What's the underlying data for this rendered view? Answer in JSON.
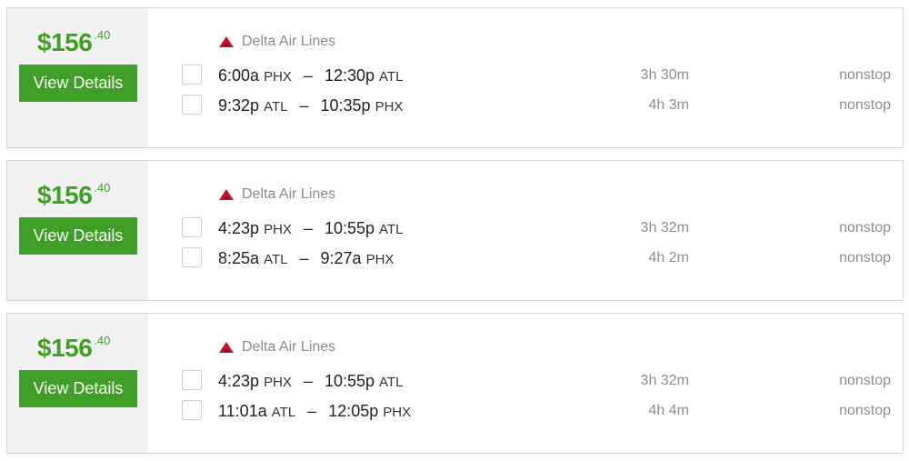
{
  "results": [
    {
      "price": {
        "dollars": "$156",
        "cents": ".40"
      },
      "button_label": "View Details",
      "airline": {
        "name": "Delta Air Lines",
        "logo_icon": "delta-logo-icon",
        "logo_color": "#c8102e"
      },
      "legs": [
        {
          "depart_time": "6:00a",
          "depart_code": "PHX",
          "arrive_time": "12:30p",
          "arrive_code": "ATL",
          "separator": "–",
          "duration": "3h 30m",
          "stops": "nonstop"
        },
        {
          "depart_time": "9:32p",
          "depart_code": "ATL",
          "arrive_time": "10:35p",
          "arrive_code": "PHX",
          "separator": "–",
          "duration": "4h 3m",
          "stops": "nonstop"
        }
      ]
    },
    {
      "price": {
        "dollars": "$156",
        "cents": ".40"
      },
      "button_label": "View Details",
      "airline": {
        "name": "Delta Air Lines",
        "logo_icon": "delta-logo-icon",
        "logo_color": "#c8102e"
      },
      "legs": [
        {
          "depart_time": "4:23p",
          "depart_code": "PHX",
          "arrive_time": "10:55p",
          "arrive_code": "ATL",
          "separator": "–",
          "duration": "3h 32m",
          "stops": "nonstop"
        },
        {
          "depart_time": "8:25a",
          "depart_code": "ATL",
          "arrive_time": "9:27a",
          "arrive_code": "PHX",
          "separator": "–",
          "duration": "4h 2m",
          "stops": "nonstop"
        }
      ]
    },
    {
      "price": {
        "dollars": "$156",
        "cents": ".40"
      },
      "button_label": "View Details",
      "airline": {
        "name": "Delta Air Lines",
        "logo_icon": "delta-logo-icon",
        "logo_color": "#c8102e"
      },
      "legs": [
        {
          "depart_time": "4:23p",
          "depart_code": "PHX",
          "arrive_time": "10:55p",
          "arrive_code": "ATL",
          "separator": "–",
          "duration": "3h 32m",
          "stops": "nonstop"
        },
        {
          "depart_time": "11:01a",
          "depart_code": "ATL",
          "arrive_time": "12:05p",
          "arrive_code": "PHX",
          "separator": "–",
          "duration": "4h 4m",
          "stops": "nonstop"
        }
      ]
    }
  ],
  "colors": {
    "price_green": "#3f9f26",
    "button_green": "#3f9f26",
    "muted_text": "#8e8e8e",
    "price_panel_bg": "#f1f1f1"
  }
}
